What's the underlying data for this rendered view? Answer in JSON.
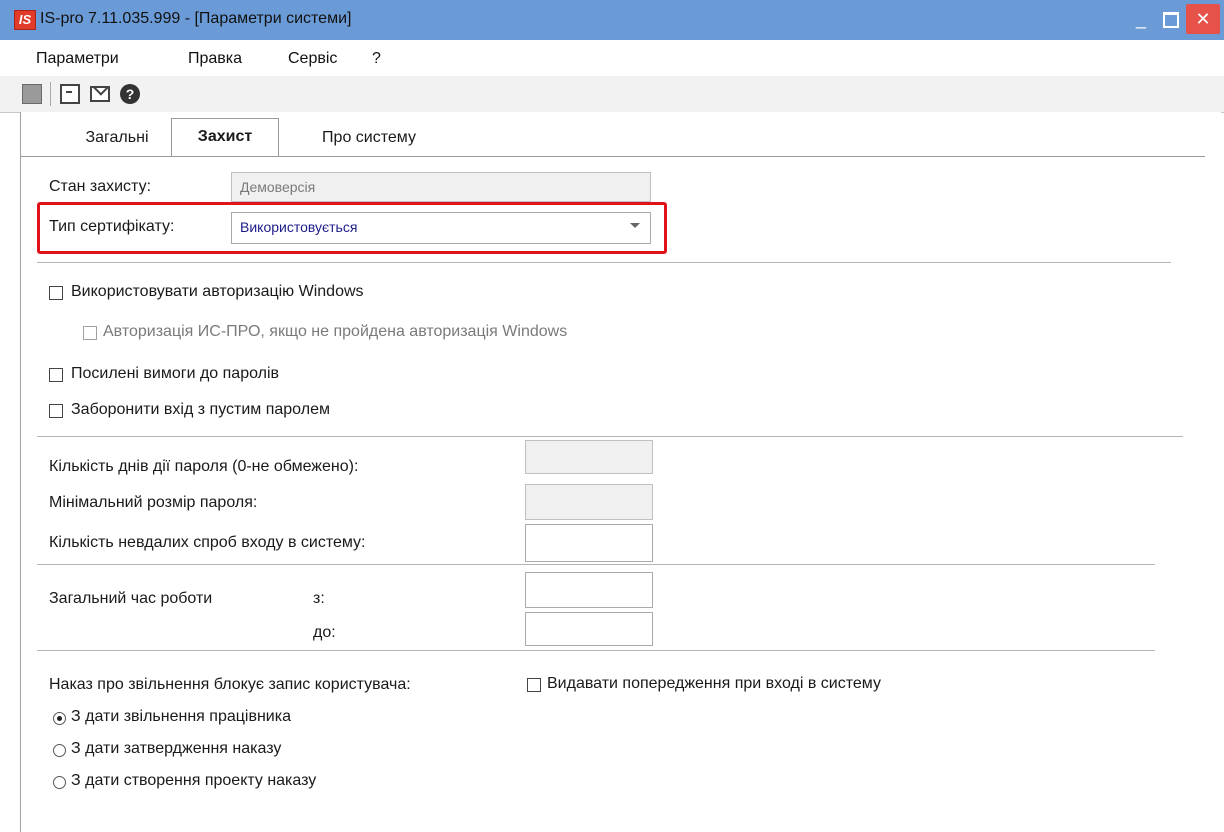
{
  "window": {
    "logo_text": "IS",
    "title": "IS-pro 7.11.035.999 - [Параметри системи]",
    "minimize": "_",
    "close": "✕"
  },
  "menu": [
    "Параметри",
    "Правка",
    "Сервіс",
    "?"
  ],
  "toolbar": {
    "icons": [
      "stop-icon",
      "form-icon",
      "mail-icon",
      "help-icon"
    ],
    "help_glyph": "?"
  },
  "tabs": [
    {
      "label": "Загальні",
      "active": false
    },
    {
      "label": "Захист",
      "active": true
    },
    {
      "label": "Про систему",
      "active": false
    }
  ],
  "security": {
    "state_label": "Стан захисту:",
    "state_value": "Демоверсія",
    "cert_type_label": "Тип сертифікату:",
    "cert_type_value": "Використовується",
    "highlight_color": "#e0131b",
    "use_windows_auth": {
      "label": "Використовувати авторизацію Windows",
      "checked": false
    },
    "ispro_auth_fallback": {
      "label": "Авторизація ИС-ПРО, якщо не пройдена авторизація Windows",
      "checked": false,
      "enabled": false
    },
    "strong_passwords": {
      "label": "Посилені вимоги до паролів",
      "checked": false
    },
    "forbid_empty_password": {
      "label": "Заборонити вхід з пустим паролем",
      "checked": false
    },
    "password_days_label": "Кількість днів дії пароля (0-не обмежено):",
    "password_days_value": "",
    "min_password_label": "Мінімальний розмір пароля:",
    "min_password_value": "",
    "failed_attempts_label": "Кількість невдалих спроб входу в систему:",
    "failed_attempts_value": "",
    "work_time_label": "Загальний час роботи",
    "from_label": "з:",
    "from_value": "",
    "to_label": "до:",
    "to_value": "",
    "dismissal_label": "Наказ про звільнення блокує запис користувача:",
    "warn_on_login": {
      "label": "Видавати попередження при вході в систему",
      "checked": false
    },
    "dismissal_options": [
      {
        "label": "З дати звільнення працівника",
        "selected": true
      },
      {
        "label": "З дати затвердження наказу",
        "selected": false
      },
      {
        "label": "З дати створення проекту наказу",
        "selected": false
      }
    ]
  }
}
